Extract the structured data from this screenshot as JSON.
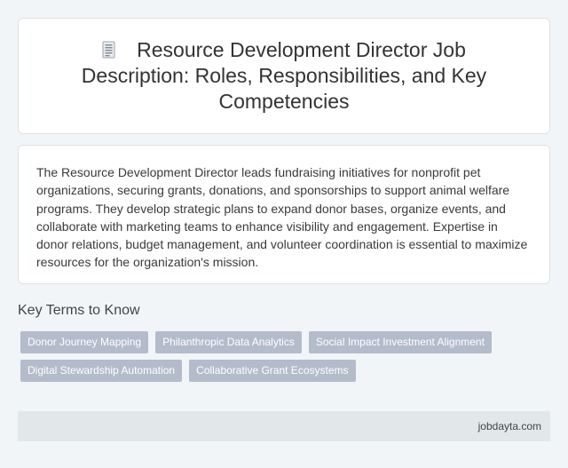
{
  "header": {
    "icon": "document-icon",
    "title": "Resource Development Director Job Description: Roles, Responsibilities, and Key Competencies"
  },
  "description": "The Resource Development Director leads fundraising initiatives for nonprofit pet organizations, securing grants, donations, and sponsorships to support animal welfare programs. They develop strategic plans to expand donor bases, organize events, and collaborate with marketing teams to enhance visibility and engagement. Expertise in donor relations, budget management, and volunteer coordination is essential to maximize resources for the organization's mission.",
  "key_terms": {
    "heading": "Key Terms to Know",
    "tags": [
      "Donor Journey Mapping",
      "Philanthropic Data Analytics",
      "Social Impact Investment Alignment",
      "Digital Stewardship Automation",
      "Collaborative Grant Ecosystems"
    ]
  },
  "footer": {
    "site": "jobdayta.com"
  },
  "colors": {
    "background": "#f2f5f7",
    "card": "#ffffff",
    "tag_background": "#b4bccb",
    "tag_text": "#ffffff",
    "footer_background": "#e2e8e9"
  }
}
